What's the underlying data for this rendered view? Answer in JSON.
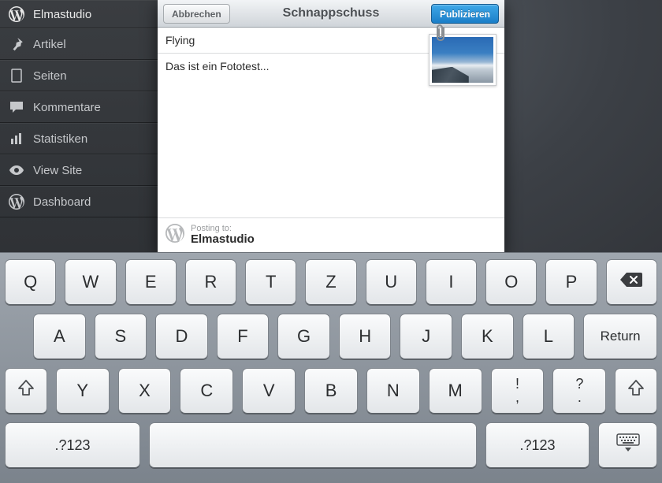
{
  "sidebar": {
    "site": "Elmastudio",
    "items": [
      {
        "label": "Artikel",
        "icon": "pin"
      },
      {
        "label": "Seiten",
        "icon": "page"
      },
      {
        "label": "Kommentare",
        "icon": "comment"
      },
      {
        "label": "Statistiken",
        "icon": "stats"
      },
      {
        "label": "View Site",
        "icon": "eye"
      },
      {
        "label": "Dashboard",
        "icon": "wordpress"
      }
    ]
  },
  "modal": {
    "title": "Schnappschuss",
    "cancel": "Abbrechen",
    "publish": "Publizieren",
    "post_title": "Flying",
    "post_body": "Das ist ein Fototest...",
    "posting_to_label": "Posting to:",
    "posting_to_site": "Elmastudio"
  },
  "keyboard": {
    "row1": [
      "Q",
      "W",
      "E",
      "R",
      "T",
      "Z",
      "U",
      "I",
      "O",
      "P"
    ],
    "row2": [
      "A",
      "S",
      "D",
      "F",
      "G",
      "H",
      "J",
      "K",
      "L"
    ],
    "return": "Return",
    "row3": [
      "Y",
      "X",
      "C",
      "V",
      "B",
      "N",
      "M"
    ],
    "punct1_top": "!",
    "punct1_bot": ",",
    "punct2_top": "?",
    "punct2_bot": ".",
    "numswitch": ".?123"
  }
}
